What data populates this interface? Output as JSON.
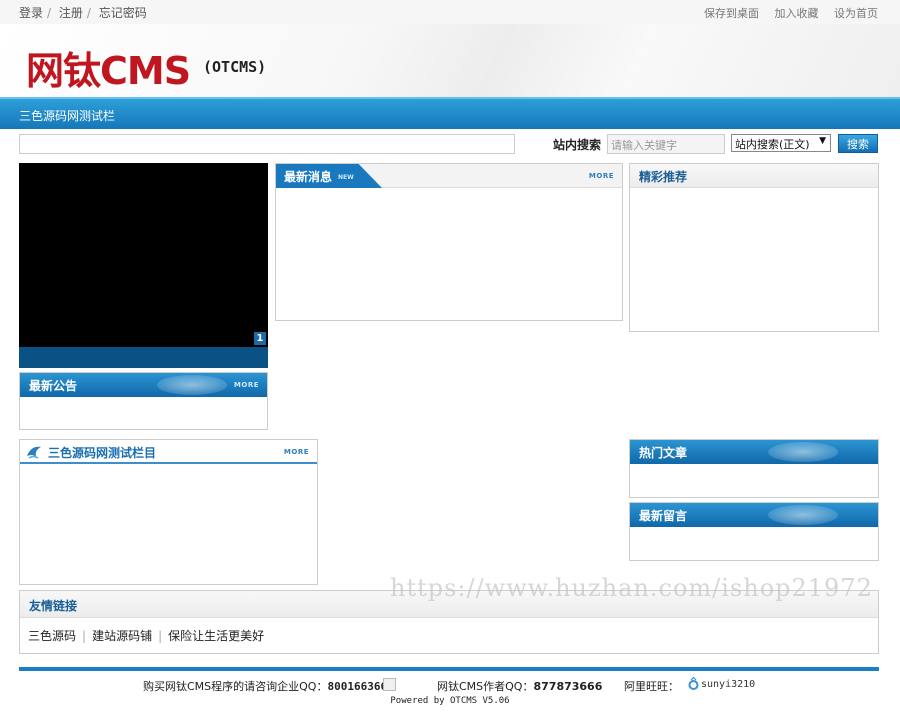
{
  "topbar": {
    "login": "登录",
    "register": "注册",
    "forgot": "忘记密码",
    "sep": "/",
    "save_desktop": "保存到桌面",
    "add_favorite": "加入收藏",
    "set_home": "设为首页"
  },
  "logo": {
    "main": "网钛CMS",
    "sub": "(OTCMS)"
  },
  "nav": {
    "item": "三色源码网测试栏"
  },
  "search": {
    "label": "站内搜索",
    "placeholder": "请输入关键字",
    "select_value": "站内搜索(正文)",
    "button": "搜索"
  },
  "slider": {
    "page": "1"
  },
  "panels": {
    "latest_news": {
      "title": "最新消息",
      "badge": "NEW",
      "more": "MORE"
    },
    "featured": {
      "title": "精彩推荐"
    },
    "notice": {
      "title": "最新公告",
      "more": "MORE"
    },
    "column": {
      "title": "三色源码网测试栏目",
      "more": "MORE"
    },
    "hot": {
      "title": "热门文章"
    },
    "messages": {
      "title": "最新留言"
    },
    "links": {
      "title": "友情链接",
      "items": [
        "三色源码",
        "建站源码铺",
        "保险让生活更美好"
      ],
      "sep": "|"
    }
  },
  "watermark": "https://www.huzhan.com/ishop21972",
  "footer": {
    "buy_text": "购买网钛CMS程序的请咨询企业QQ：",
    "buy_qq": "800166366",
    "author_text": "网钛CMS作者QQ：",
    "author_qq": "877873666",
    "wangwang_label": "阿里旺旺：",
    "wangwang_id": "sunyi3210",
    "powered": "Powered by OTCMS V5.06"
  },
  "colors": {
    "brand_red": "#c0161f",
    "brand_blue": "#1577b8"
  }
}
